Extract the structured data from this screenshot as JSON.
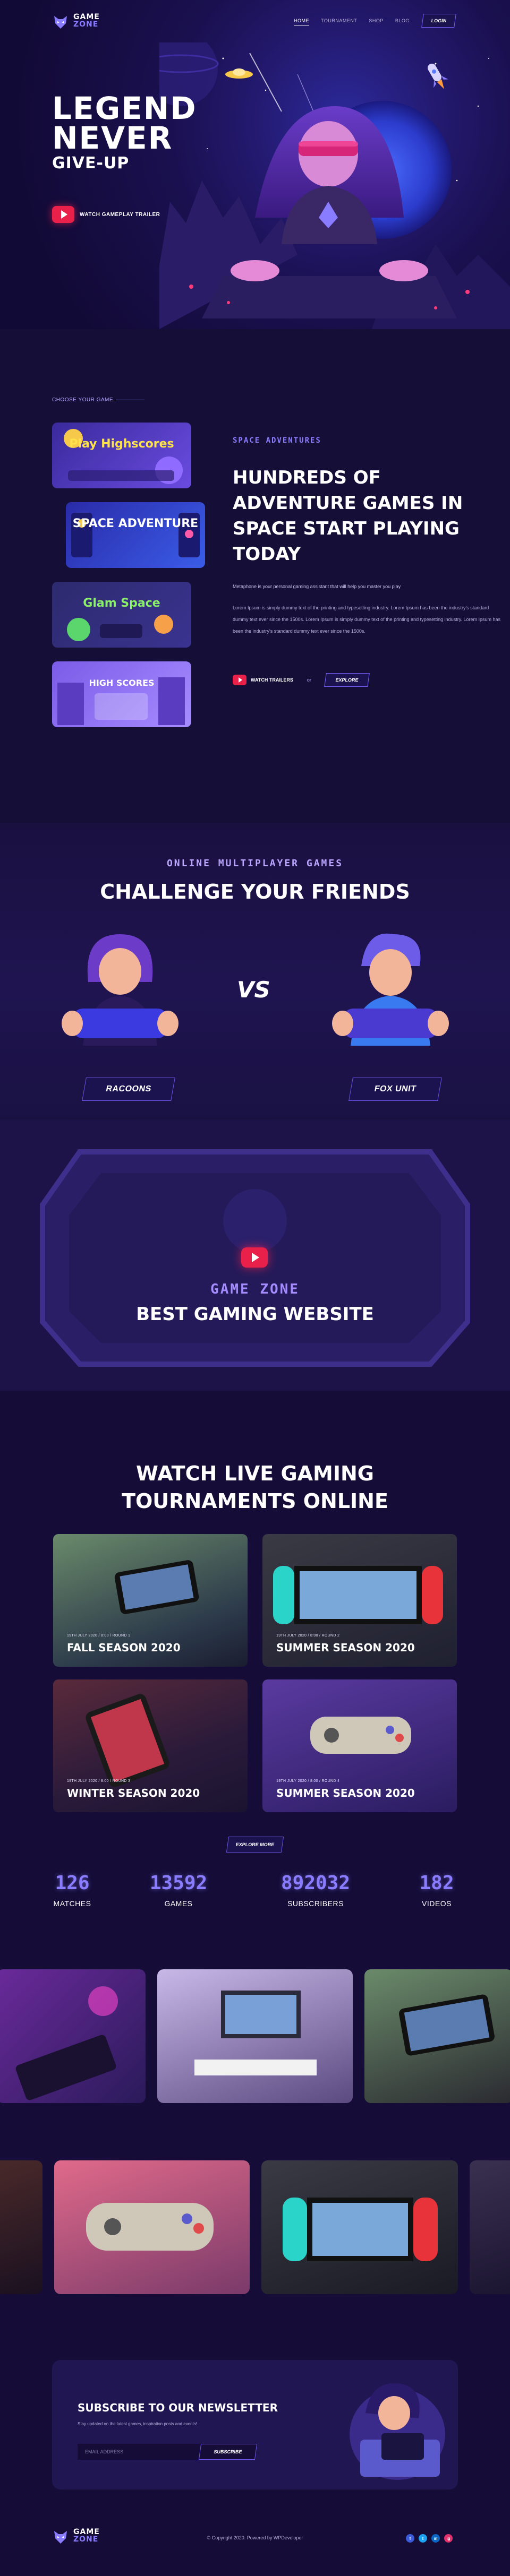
{
  "brand": {
    "line1": "GAME",
    "line2": "ZONE"
  },
  "nav": {
    "links": [
      "HOME",
      "TOURNAMENT",
      "SHOP",
      "BLOG"
    ],
    "login": "LOGIN"
  },
  "hero": {
    "title_line1": "LEGEND",
    "title_line2": "NEVER",
    "title_line3": "GIVE-UP",
    "trailer_label": "WATCH GAMEPLAY TRAILER"
  },
  "choose": {
    "label": "CHOOSE YOUR GAME",
    "cards": [
      "Play Highscores",
      "SPACE ADVENTURE",
      "Glam Space",
      "HIGH SCORES"
    ]
  },
  "adventure": {
    "eyebrow": "SPACE ADVENTURES",
    "title": "HUNDREDS OF ADVENTURE GAMES IN SPACE START PLAYING TODAY",
    "intro": "Metaphone is your personal gaming assistant that will help you master you play",
    "body": "Lorem Ipsum is simply dummy text of the printing and typesetting industry. Lorem Ipsum has been the industry's standard dummy text ever since the 1500s. Lorem Ipsum is simply dummy text of the printing and typesetting industry. Lorem Ipsum has been the industry's standard dummy text ever since the 1500s.",
    "trailer_label": "WATCH TRAILERS",
    "or": "or",
    "explore": "EXPLORE"
  },
  "multiplayer": {
    "eyebrow": "ONLINE MULTIPLAYER GAMES",
    "title": "CHALLENGE YOUR FRIENDS",
    "vs": "VS",
    "team1": "RACOONS",
    "team2": "FOX UNIT"
  },
  "promo": {
    "eyebrow": "GAME ZONE",
    "title": "BEST GAMING WEBSITE"
  },
  "tournaments": {
    "title_line1": "WATCH LIVE GAMING",
    "title_line2": "TOURNAMENTS ONLINE",
    "cards": [
      {
        "meta": "19TH JULY 2020 / 8:00 / ROUND 1",
        "title": "FALL SEASON 2020"
      },
      {
        "meta": "19TH JULY 2020 / 8:00 / ROUND 2",
        "title": "SUMMER SEASON 2020"
      },
      {
        "meta": "19TH JULY 2020 / 8:00 / ROUND 3",
        "title": "WINTER SEASON 2020"
      },
      {
        "meta": "19TH JULY 2020 / 8:00 / ROUND 4",
        "title": "SUMMER SEASON 2020"
      }
    ],
    "explore_more": "EXPLORE MORE"
  },
  "stats": [
    {
      "value": "126",
      "label": "MATCHES"
    },
    {
      "value": "13592",
      "label": "GAMES"
    },
    {
      "value": "892032",
      "label": "SUBSCRIBERS"
    },
    {
      "value": "182",
      "label": "VIDEOS"
    }
  ],
  "newsletter": {
    "title": "SUBSCRIBE TO OUR NEWSLETTER",
    "subtitle": "Stay updated on the latest games, inspiration posts and events!",
    "placeholder": "EMAIL ADDRESS",
    "button": "SUBSCRIBE"
  },
  "footer": {
    "copyright": "© Copyright 2020. Powered by WPDeveloper",
    "socials": [
      {
        "icon": "facebook-icon",
        "glyph": "f",
        "color": "#3b5bdb"
      },
      {
        "icon": "twitter-icon",
        "glyph": "t",
        "color": "#1da1f2"
      },
      {
        "icon": "linkedin-icon",
        "glyph": "in",
        "color": "#0a66c2"
      },
      {
        "icon": "instagram-icon",
        "glyph": "ig",
        "color": "#e1306c"
      }
    ]
  },
  "colors": {
    "accent": "#8a7cff",
    "play": "#e8204a",
    "background": "#150d38"
  }
}
